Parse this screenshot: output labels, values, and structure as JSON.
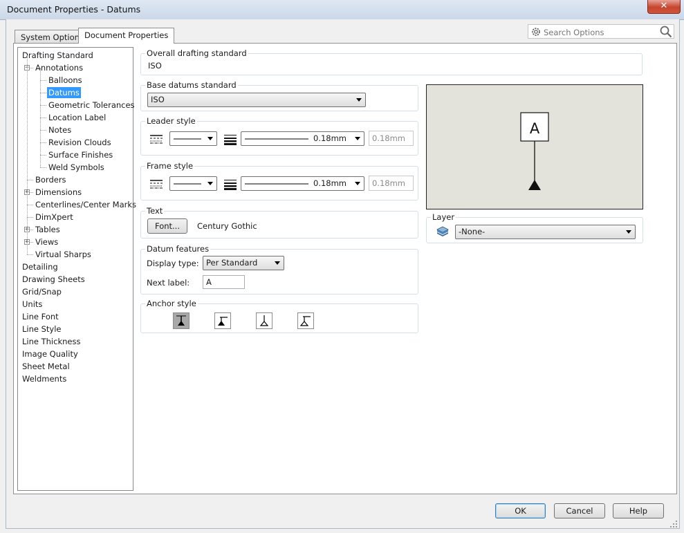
{
  "window": {
    "title": "Document Properties - Datums",
    "close_glyph": "✕"
  },
  "tabs": [
    {
      "label": "System Options",
      "active": false
    },
    {
      "label": "Document Properties",
      "active": true
    }
  ],
  "search": {
    "placeholder": "Search Options",
    "icon": "gear-icon"
  },
  "tree": {
    "items": [
      {
        "label": "Drafting Standard",
        "level": 0
      },
      {
        "label": "Annotations",
        "level": 1,
        "expander": "−"
      },
      {
        "label": "Balloons",
        "level": 2
      },
      {
        "label": "Datums",
        "level": 2,
        "selected": true
      },
      {
        "label": "Geometric Tolerances",
        "level": 2
      },
      {
        "label": "Location Label",
        "level": 2
      },
      {
        "label": "Notes",
        "level": 2
      },
      {
        "label": "Revision Clouds",
        "level": 2
      },
      {
        "label": "Surface Finishes",
        "level": 2
      },
      {
        "label": "Weld Symbols",
        "level": 2
      },
      {
        "label": "Borders",
        "level": 1
      },
      {
        "label": "Dimensions",
        "level": 1,
        "expander": "+"
      },
      {
        "label": "Centerlines/Center Marks",
        "level": 1
      },
      {
        "label": "DimXpert",
        "level": 1
      },
      {
        "label": "Tables",
        "level": 1,
        "expander": "+"
      },
      {
        "label": "Views",
        "level": 1,
        "expander": "+"
      },
      {
        "label": "Virtual Sharps",
        "level": 1
      },
      {
        "label": "Detailing",
        "level": 0
      },
      {
        "label": "Drawing Sheets",
        "level": 0
      },
      {
        "label": "Grid/Snap",
        "level": 0
      },
      {
        "label": "Units",
        "level": 0
      },
      {
        "label": "Line Font",
        "level": 0
      },
      {
        "label": "Line Style",
        "level": 0
      },
      {
        "label": "Line Thickness",
        "level": 0
      },
      {
        "label": "Image Quality",
        "level": 0
      },
      {
        "label": "Sheet Metal",
        "level": 0
      },
      {
        "label": "Weldments",
        "level": 0
      }
    ]
  },
  "overall": {
    "label": "Overall drafting standard",
    "value": "ISO"
  },
  "base_datums": {
    "label": "Base datums standard",
    "value": "ISO"
  },
  "leader_style": {
    "label": "Leader style",
    "thickness": "0.18mm",
    "custom_value": "0.18mm"
  },
  "frame_style": {
    "label": "Frame style",
    "thickness": "0.18mm",
    "custom_value": "0.18mm"
  },
  "text": {
    "label": "Text",
    "font_button": "Font...",
    "font_name": "Century Gothic"
  },
  "datum_features": {
    "label": "Datum features",
    "display_type_label": "Display type:",
    "display_type_value": "Per Standard",
    "next_label_label": "Next label:",
    "next_label_value": "A"
  },
  "anchor_style": {
    "label": "Anchor style",
    "selected_index": 0
  },
  "preview": {
    "datum_letter": "A",
    "background": "#e4e3db"
  },
  "layer": {
    "label": "Layer",
    "value": "-None-"
  },
  "footer": {
    "ok": "OK",
    "cancel": "Cancel",
    "help": "Help"
  }
}
